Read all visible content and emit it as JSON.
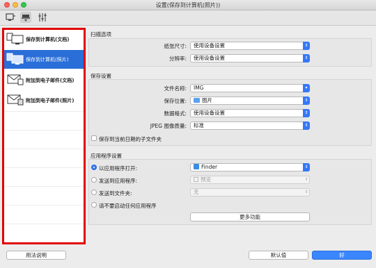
{
  "window": {
    "title": "设置(保存到计算机(照片))"
  },
  "toolbar": {
    "icons": [
      "scan-from-computer-icon",
      "scan-from-panel-icon",
      "general-settings-icon"
    ]
  },
  "sidebar": {
    "items": [
      {
        "label": "保存到计算机(文档)"
      },
      {
        "label": "保存到计算机(照片)"
      },
      {
        "label": "附加到电子邮件(文档)"
      },
      {
        "label": "附加到电子邮件(照片)"
      }
    ]
  },
  "scan_options": {
    "title": "扫描选项",
    "paper_size_label": "纸张尺寸:",
    "paper_size_value": "使用设备设置",
    "resolution_label": "分辨率:",
    "resolution_value": "使用设备设置"
  },
  "save_settings": {
    "title": "保存设置",
    "file_name_label": "文件名称:",
    "file_name_value": "IMG",
    "save_location_label": "保存位置:",
    "save_location_value": "图片",
    "data_format_label": "数据格式:",
    "data_format_value": "使用设备设置",
    "jpeg_quality_label": "JPEG 图像质量:",
    "jpeg_quality_value": "标准",
    "subfolder_label": "保存到当前日期的子文件夹"
  },
  "app_settings": {
    "title": "应用程序设置",
    "open_with_label": "以应用程序打开:",
    "open_with_value": "Finder",
    "send_to_app_label": "发送到应用程序:",
    "send_to_app_value": "预览",
    "send_to_folder_label": "发送到文件夹:",
    "send_to_folder_value": "无",
    "do_not_start_label": "请不要启动任何应用程序",
    "more_functions_label": "更多功能"
  },
  "footer": {
    "help_label": "用法说明",
    "defaults_label": "默认值",
    "ok_label": "好"
  },
  "colors": {
    "accent": "#3478f6",
    "highlight": "#e10000",
    "selection": "#2a6ed8"
  }
}
